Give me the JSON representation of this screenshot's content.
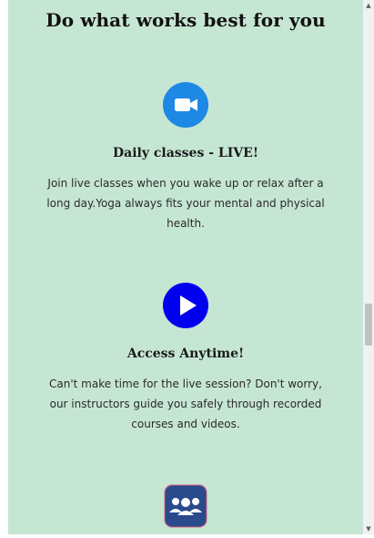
{
  "section": {
    "title": "Do what works best for you"
  },
  "features": [
    {
      "icon": "video-camera-icon",
      "title": "Daily classes - LIVE!",
      "description": "Join live classes when you wake up or relax after a long day.Yoga always fits your mental and physical health."
    },
    {
      "icon": "play-icon",
      "title": "Access Anytime!",
      "description": "Can't make time for the live session? Don't worry, our instructors guide you safely through recorded courses and videos."
    },
    {
      "icon": "group-icon"
    }
  ],
  "scrollbar": {
    "up_glyph": "▲",
    "down_glyph": "▼"
  },
  "colors": {
    "background": "#c6e6d4",
    "video_icon": "#1e88e5",
    "play_icon": "#0000ee",
    "group_icon": "#2b4a8c"
  }
}
